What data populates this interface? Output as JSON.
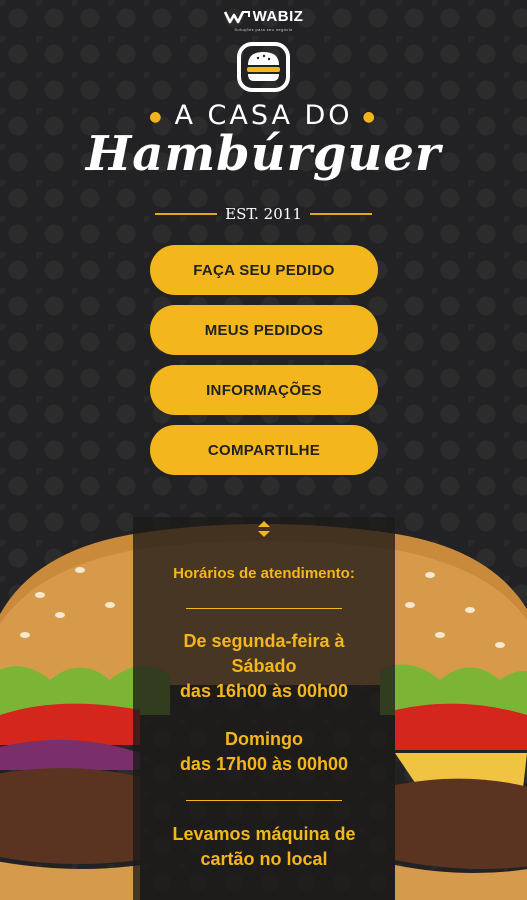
{
  "brand": {
    "name": "WABIZ",
    "tagline": "Soluções para seu negócio"
  },
  "header": {
    "title_top": "A CASA DO",
    "title_main": "Hambúrguer",
    "est": "EST. 2011"
  },
  "menu": [
    {
      "label": "FAÇA SEU PEDIDO"
    },
    {
      "label": "MEUS PEDIDOS"
    },
    {
      "label": "INFORMAÇÕES"
    },
    {
      "label": "COMPARTILHE"
    }
  ],
  "hours": {
    "heading": "Horários de atendimento:",
    "weekday_line1": "De segunda-feira à",
    "weekday_line2": "Sábado",
    "weekday_time": "das 16h00 às 00h00",
    "sunday_label": "Domingo",
    "sunday_time": "das 17h00 às 00h00",
    "card_line1": "Levamos máquina de",
    "card_line2": "cartão no local"
  },
  "colors": {
    "accent": "#f3b61c",
    "background": "#222224",
    "text": "#ffffff"
  },
  "icons": {
    "logo": "burger-logo-icon",
    "toggle": "expand-toggle-icon"
  }
}
